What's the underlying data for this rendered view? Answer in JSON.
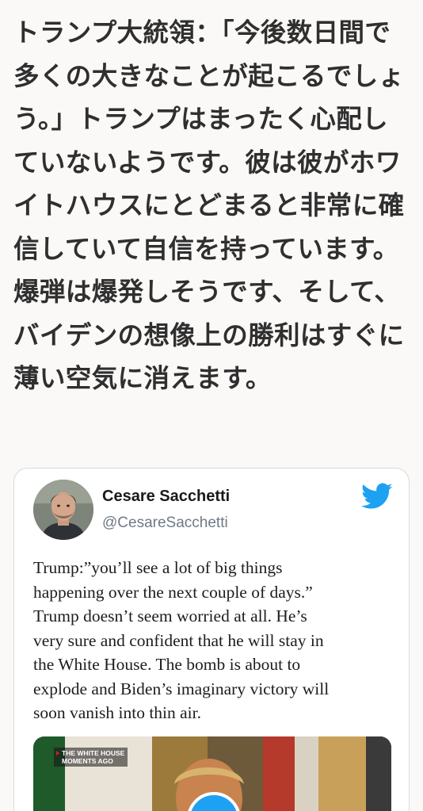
{
  "article": {
    "lines": [
      "トランプ大統領：「今後数日間で",
      "多くの大きなことが起こるでしょ",
      "う。」トランプはまったく心配し",
      "ていないようです。彼は彼がホワ",
      "イトハウスにとどまると非常に確",
      "信していて自信を持っています。",
      "爆弾は爆発しそうです、そして、",
      "バイデンの想像上の勝利はすぐに",
      "薄い空気に消えます。"
    ]
  },
  "tweet": {
    "author_name": "Cesare Sacchetti",
    "author_handle": "@CesareSacchetti",
    "text_lines": [
      "Trump:”you’ll see a lot of big things",
      "happening over the next couple of days.”",
      "Trump doesn’t seem worried at all. He’s",
      "very sure and confident that he will stay in",
      "the White House. The bomb is about to",
      "explode and Biden’s imaginary victory will",
      "soon vanish into thin air."
    ],
    "media": {
      "label_line1": "THE WHITE HOUSE",
      "label_line2": "MOMENTS AGO"
    },
    "icons": {
      "avatar": "avatar-photo",
      "brand": "twitter-bird-icon",
      "play": "play-icon"
    },
    "colors": {
      "brand": "#1da1f2",
      "handle": "#6e7a85",
      "border": "#d6dbe0"
    }
  }
}
